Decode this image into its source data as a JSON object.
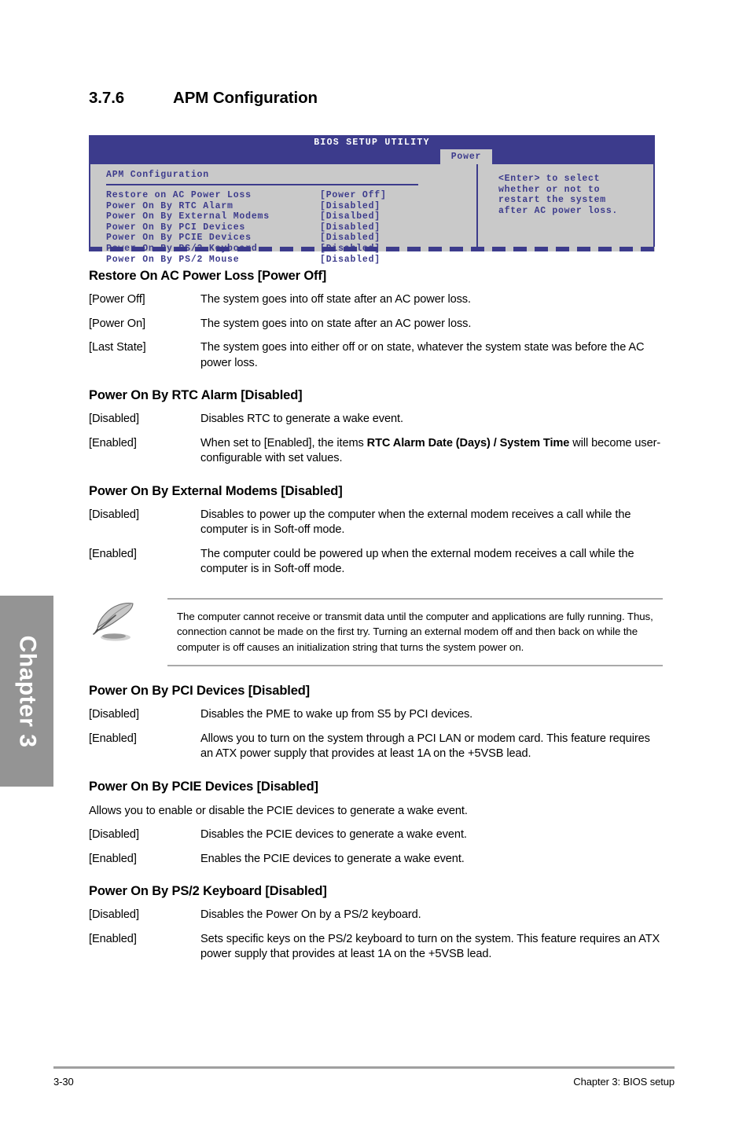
{
  "chapter_tab": {
    "label": "Chapter 3"
  },
  "section": {
    "number": "3.7.6",
    "title": "APM Configuration"
  },
  "bios_screen": {
    "title": "BIOS SETUP UTILITY",
    "active_tab": "Power",
    "panel_title": "APM Configuration",
    "items": [
      {
        "label": "Restore on AC Power Loss",
        "value": "[Power Off]"
      },
      {
        "label": "Power On By RTC Alarm",
        "value": "[Disabled]"
      },
      {
        "label": "Power On By External Modems",
        "value": "[Disalbed]"
      },
      {
        "label": "Power On By PCI Devices",
        "value": "[Disabled]"
      },
      {
        "label": "Power On By PCIE Devices",
        "value": "[Disabled]"
      },
      {
        "label": "Power On By PS/2 Keyboard",
        "value": "[Disabled]"
      },
      {
        "label": "Power On By PS/2 Mouse",
        "value": "[Disabled]"
      }
    ],
    "help_lines": [
      "<Enter> to select",
      "whether or not to",
      "restart the system",
      "after AC power loss."
    ],
    "colors": {
      "header_blue": "#3c3b8c",
      "panel_gray": "#c9c9c9",
      "text_blue": "#3c3b8c"
    }
  },
  "options": [
    {
      "heading": "Restore On AC Power Loss [Power Off]",
      "rows": [
        {
          "term": "[Power Off]",
          "desc": "The system goes into off state after an AC power loss."
        },
        {
          "term": "[Power On]",
          "desc": "The system goes into on state after an AC power loss."
        },
        {
          "term": "[Last State]",
          "desc": "The system goes into either off or on state, whatever the system state was before the AC power loss."
        }
      ]
    },
    {
      "heading": "Power On By RTC Alarm [Disabled]",
      "rows": [
        {
          "term": "[Disabled]",
          "desc": "Disables RTC to generate a wake event."
        },
        {
          "term": "[Enabled]",
          "desc_pre": "When set to [Enabled], the items ",
          "desc_bold": "RTC Alarm Date (Days) / System Time",
          "desc_post": " will become user-configurable with set values."
        }
      ]
    },
    {
      "heading": "Power On By External Modems [Disabled]",
      "rows": [
        {
          "term": "[Disabled]",
          "desc": "Disables to power up the computer when the external modem receives a call while the computer is in Soft-off mode."
        },
        {
          "term": "[Enabled]",
          "desc": "The computer could be powered up when the external modem receives a call while the computer is in Soft-off mode."
        }
      ]
    }
  ],
  "note": {
    "icon": "quill-pen-icon",
    "text": "The computer cannot receive or transmit data until the computer and applications are fully running. Thus, connection cannot be made on the first try. Turning an external modem off and then back on while the computer is off causes an initialization string that turns the system power on."
  },
  "options2": [
    {
      "heading": "Power On By PCI Devices [Disabled]",
      "rows": [
        {
          "term": "[Disabled]",
          "desc": "Disables the PME to wake up from S5 by PCI devices."
        },
        {
          "term": "[Enabled]",
          "desc": "Allows you to turn on the system through a PCI LAN or modem card. This feature requires an ATX power supply that provides at least 1A on the +5VSB lead."
        }
      ]
    }
  ],
  "pcie_section": {
    "heading": "Power On By PCIE Devices [Disabled]",
    "intro": "Allows you to enable or disable the PCIE devices to generate a wake event.",
    "rows": [
      {
        "term": "[Disabled]",
        "desc": "Disables the PCIE devices to generate a wake event."
      },
      {
        "term": "[Enabled]",
        "desc": "Enables the PCIE devices to generate a wake event."
      }
    ]
  },
  "ps2_section": {
    "heading": "Power On By PS/2 Keyboard [Disabled]",
    "rows": [
      {
        "term": "[Disabled]",
        "desc": "Disables the Power On by a PS/2 keyboard."
      },
      {
        "term": "[Enabled]",
        "desc": "Sets specific keys on the PS/2 keyboard to turn on the system. This feature requires an ATX power supply that provides at least 1A on the +5VSB lead."
      }
    ]
  },
  "footer": {
    "page_number": "3-30",
    "chapter_label": "Chapter 3: BIOS setup"
  }
}
